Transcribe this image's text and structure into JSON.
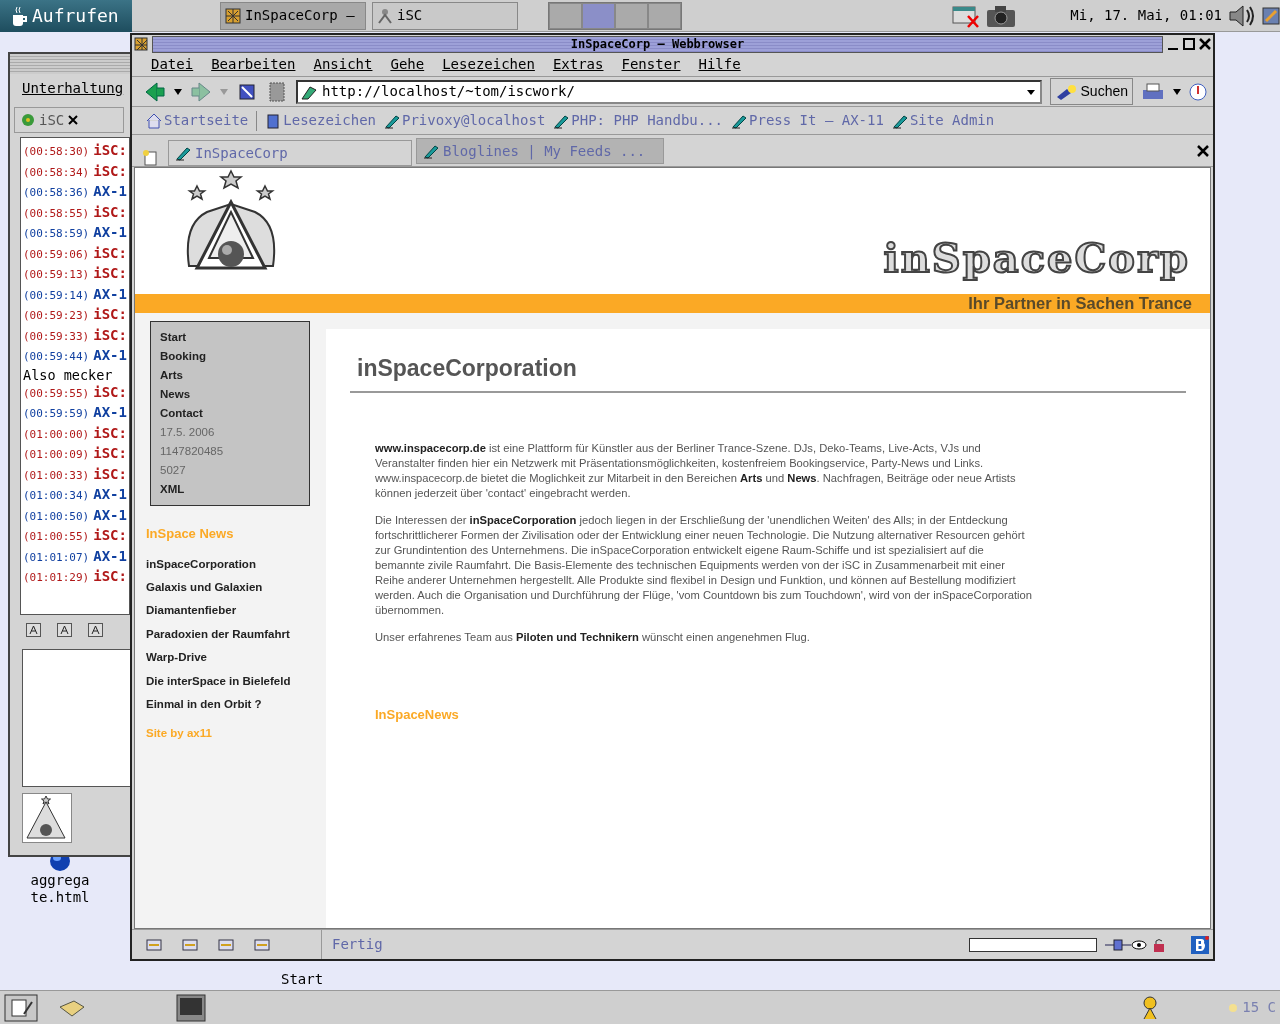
{
  "top_panel": {
    "start_button": "Aufrufen",
    "tasks": [
      {
        "label": "InSpaceCorp –",
        "selected": true
      },
      {
        "label": "iSC",
        "selected": false
      }
    ],
    "pager": [
      {
        "selected": false
      },
      {
        "selected": true
      },
      {
        "selected": false
      },
      {
        "selected": false
      }
    ],
    "clock": "Mi, 17. Mai, 01:01"
  },
  "desktop_icons": [
    {
      "label": "aggregate.html"
    },
    {
      "label": "Start"
    }
  ],
  "chat_window": {
    "menu": "Unterhaltung",
    "tab": "iSC",
    "messages": [
      {
        "time": "(00:58:30)",
        "sender": "iSC:",
        "kind": "remote"
      },
      {
        "time": "(00:58:34)",
        "sender": "iSC:",
        "kind": "remote"
      },
      {
        "time": "(00:58:36)",
        "sender": "AX-1",
        "kind": "local"
      },
      {
        "time": "(00:58:55)",
        "sender": "iSC:",
        "kind": "remote"
      },
      {
        "time": "(00:58:59)",
        "sender": "AX-1",
        "kind": "local"
      },
      {
        "time": "(00:59:06)",
        "sender": "iSC:",
        "kind": "remote"
      },
      {
        "time": "(00:59:13)",
        "sender": "iSC:",
        "kind": "remote"
      },
      {
        "time": "(00:59:14)",
        "sender": "AX-1",
        "kind": "local"
      },
      {
        "time": "(00:59:23)",
        "sender": "iSC:",
        "kind": "remote"
      },
      {
        "time": "(00:59:33)",
        "sender": "iSC:",
        "kind": "remote"
      },
      {
        "time": "(00:59:44)",
        "sender": "AX-1",
        "kind": "local"
      },
      {
        "text": "Also mecker",
        "kind": "plain"
      },
      {
        "time": "(00:59:55)",
        "sender": "iSC:",
        "kind": "remote"
      },
      {
        "time": "(00:59:59)",
        "sender": "AX-1",
        "kind": "local"
      },
      {
        "time": "(01:00:00)",
        "sender": "iSC:",
        "kind": "remote"
      },
      {
        "time": "(01:00:09)",
        "sender": "iSC:",
        "kind": "remote"
      },
      {
        "time": "(01:00:33)",
        "sender": "iSC:",
        "kind": "remote"
      },
      {
        "time": "(01:00:34)",
        "sender": "AX-1",
        "kind": "local"
      },
      {
        "time": "(01:00:50)",
        "sender": "AX-1",
        "kind": "local"
      },
      {
        "time": "(01:00:55)",
        "sender": "iSC:",
        "kind": "remote"
      },
      {
        "time": "(01:01:07)",
        "sender": "AX-1",
        "kind": "local"
      },
      {
        "time": "(01:01:29)",
        "sender": "iSC:",
        "kind": "remote"
      }
    ]
  },
  "browser": {
    "title": "InSpaceCorp – Webbrowser",
    "menu": [
      "Datei",
      "Bearbeiten",
      "Ansicht",
      "Gehe",
      "Lesezeichen",
      "Extras",
      "Fenster",
      "Hilfe"
    ],
    "url": "http://localhost/~tom/iscwork/",
    "search_button": "Suchen",
    "bookmarks": [
      "Startseite",
      "Lesezeichen",
      "Privoxy@localhost",
      "PHP: PHP Handbu...",
      "Press It – AX-11",
      "Site Admin"
    ],
    "tabs": [
      {
        "label": "InSpaceCorp",
        "selected": true
      },
      {
        "label": "Bloglines | My Feeds ...",
        "selected": false
      }
    ],
    "page": {
      "logo": "inSpaceCorp",
      "tagline": "Ihr Partner in Sachen Trance",
      "nav": [
        {
          "label": "Start",
          "kind": "link"
        },
        {
          "label": "Booking",
          "kind": "link"
        },
        {
          "label": "Arts",
          "kind": "link"
        },
        {
          "label": "News",
          "kind": "link"
        },
        {
          "label": "Contact",
          "kind": "link"
        },
        {
          "label": "17.5. 2006",
          "kind": "info"
        },
        {
          "label": "1147820485",
          "kind": "info"
        },
        {
          "label": "5027",
          "kind": "info"
        },
        {
          "label": "XML",
          "kind": "link"
        }
      ],
      "news_heading": "InSpace News",
      "news": [
        "inSpaceCorporation",
        "Galaxis und Galaxien",
        "Diamantenfieber",
        "Paradoxien der Raumfahrt",
        "Warp-Drive",
        "Die interSpace in Bielefeld",
        "Einmal in den Orbit ?"
      ],
      "credit": "Site by ax11",
      "heading": "inSpaceCorporation",
      "paragraphs": [
        "**www.inspacecorp.de** ist eine Plattform für Künstler aus der Berliner Trance-Szene. DJs, Deko-Teams, Live-Acts, VJs und Veranstalter finden hier ein Netzwerk mit Präsentationsmöglichkeiten, kostenfreiem Bookingservice, Party-News und Links.\nwww.inspacecorp.de bietet die Moglichkeit zur Mitarbeit in den Bereichen **Arts** und **News**. Nachfragen, Beiträge oder neue Artists können jederzeit über 'contact' eingebracht werden.",
        "Die Interessen der **inSpaceCorporation** jedoch liegen in der Erschließung der 'unendlichen Weiten' des Alls; in der Entdeckung fortschrittlicherer Formen der Zivilisation oder der Entwicklung einer neuen Technologie. Die Nutzung alternativer Resourcen gehört zur Grundintention des Unternehmens. Die inSpaceCorporation entwickelt eigene Raum-Schiffe und ist spezialisiert auf die bemannte zivile Raumfahrt. Die Basis-Elemente des technischen Equipments werden von der iSC in Zusammenarbeit mit einer Reihe anderer Unternehmen hergestellt. Alle Produkte sind flexibel in Design und Funktion, und können auf Bestellung modifiziert werden. Auch die Organisation und Durchführung der Flüge, 'vom Countdown bis zum Touchdown', wird von der inSpaceCorporation übernommen.",
        "Unser erfahrenes Team aus **Piloten und Technikern** wünscht einen angenehmen Flug."
      ],
      "news_link": "InSpaceNews"
    },
    "status": "Fertig",
    "progress": {
      "level": 0
    }
  },
  "bottom_panel": {
    "weather": "15 C"
  }
}
